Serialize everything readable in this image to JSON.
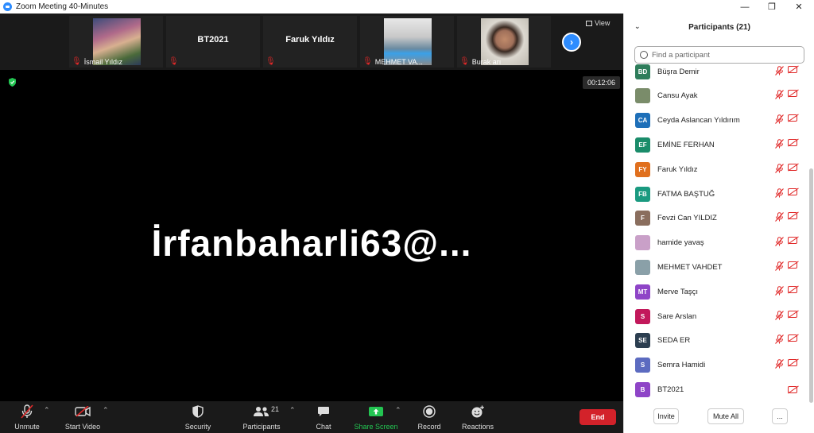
{
  "window": {
    "title": "Zoom Meeting 40-Minutes",
    "minimize": "—",
    "maximize": "❐",
    "close": "✕"
  },
  "thumbnails": [
    {
      "label": "İsmail Yıldız",
      "big_name": ""
    },
    {
      "label": "",
      "big_name": "BT2021"
    },
    {
      "label": "",
      "big_name": "Faruk Yıldız"
    },
    {
      "label": "MEHMET VA...",
      "big_name": ""
    },
    {
      "label": "Burak arı",
      "big_name": ""
    }
  ],
  "view_label": "View",
  "timer": "00:12:06",
  "main_speaker_name": "İrfanbaharli63@...",
  "toolbar": {
    "unmute": "Unmute",
    "start_video": "Start Video",
    "security": "Security",
    "participants": "Participants",
    "participants_count": "21",
    "chat": "Chat",
    "share_screen": "Share Screen",
    "record": "Record",
    "reactions": "Reactions",
    "end": "End"
  },
  "panel": {
    "title": "Participants (21)",
    "search_placeholder": "Find a participant",
    "participants": [
      {
        "initials": "BD",
        "name": "Büşra Demir",
        "color": "#2e7d5b",
        "mic_muted": true,
        "video_off": true
      },
      {
        "initials": "",
        "name": "Cansu Ayak",
        "color": "#7a8c6a",
        "mic_muted": true,
        "video_off": true
      },
      {
        "initials": "CA",
        "name": "Ceyda Aslancan Yıldırım",
        "color": "#1e6fb8",
        "mic_muted": true,
        "video_off": true
      },
      {
        "initials": "EF",
        "name": "EMİNE FERHAN",
        "color": "#1a8c6a",
        "mic_muted": true,
        "video_off": true
      },
      {
        "initials": "FY",
        "name": "Faruk Yıldız",
        "color": "#e0701e",
        "mic_muted": true,
        "video_off": true
      },
      {
        "initials": "FB",
        "name": "FATMA BAŞTUĞ",
        "color": "#1a9a80",
        "mic_muted": true,
        "video_off": true
      },
      {
        "initials": "F",
        "name": "Fevzi Can YILDIZ",
        "color": "#8a6e5e",
        "mic_muted": true,
        "video_off": true
      },
      {
        "initials": "",
        "name": "hamide yavaş",
        "color": "#c9a0c8",
        "mic_muted": true,
        "video_off": true
      },
      {
        "initials": "",
        "name": "MEHMET VAHDET",
        "color": "#8aa0a8",
        "mic_muted": true,
        "video_off": true
      },
      {
        "initials": "MT",
        "name": "Merve Taşçı",
        "color": "#8e44c7",
        "mic_muted": true,
        "video_off": true
      },
      {
        "initials": "S",
        "name": "Sare Arslan",
        "color": "#c2185b",
        "mic_muted": true,
        "video_off": true
      },
      {
        "initials": "SE",
        "name": "SEDA ER",
        "color": "#2c3e50",
        "mic_muted": true,
        "video_off": true
      },
      {
        "initials": "S",
        "name": "Semra Hamidi",
        "color": "#5c6bc0",
        "mic_muted": true,
        "video_off": true
      },
      {
        "initials": "B",
        "name": "BT2021",
        "color": "#8e44c7",
        "mic_muted": false,
        "video_off": true
      }
    ],
    "invite": "Invite",
    "mute_all": "Mute All",
    "more": "..."
  }
}
